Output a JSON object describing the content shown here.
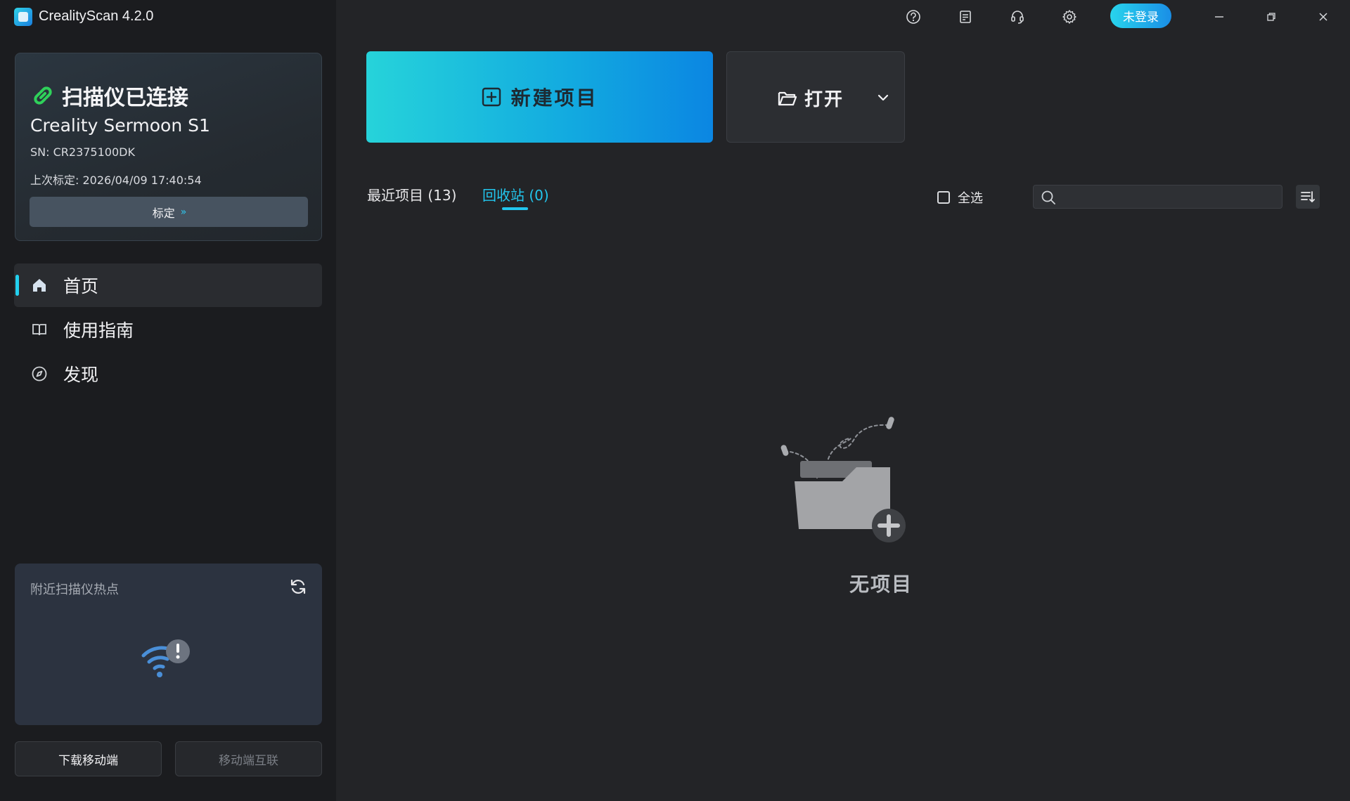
{
  "app": {
    "title": "CrealityScan 4.2.0"
  },
  "scanner": {
    "status": "扫描仪已连接",
    "model": "Creality Sermoon S1",
    "sn": "SN: CR2375100DK",
    "last_calibration": "上次标定: 2026/04/09 17:40:54",
    "calibrate_label": "标定",
    "calibrate_chevron": "»"
  },
  "nav": {
    "items": [
      {
        "label": "首页",
        "icon": "home-icon",
        "active": true
      },
      {
        "label": "使用指南",
        "icon": "book-icon",
        "active": false
      },
      {
        "label": "发现",
        "icon": "compass-icon",
        "active": false
      }
    ]
  },
  "hotspot": {
    "title": "附近扫描仪热点"
  },
  "bottom_buttons": {
    "download": "下载移动端",
    "mobile_connect": "移动端互联"
  },
  "header": {
    "login_label": "未登录"
  },
  "actions": {
    "new_project": "新建项目",
    "open": "打开"
  },
  "tabs": {
    "recent": "最近项目 (13)",
    "trash": "回收站 (0)"
  },
  "toolbar": {
    "select_all": "全选",
    "search_placeholder": ""
  },
  "empty": {
    "text": "无项目"
  },
  "colors": {
    "accent": "#22c6ee",
    "connected": "#2fd15a",
    "sidebar_bg": "#1b1c1f",
    "main_bg": "#232427"
  }
}
